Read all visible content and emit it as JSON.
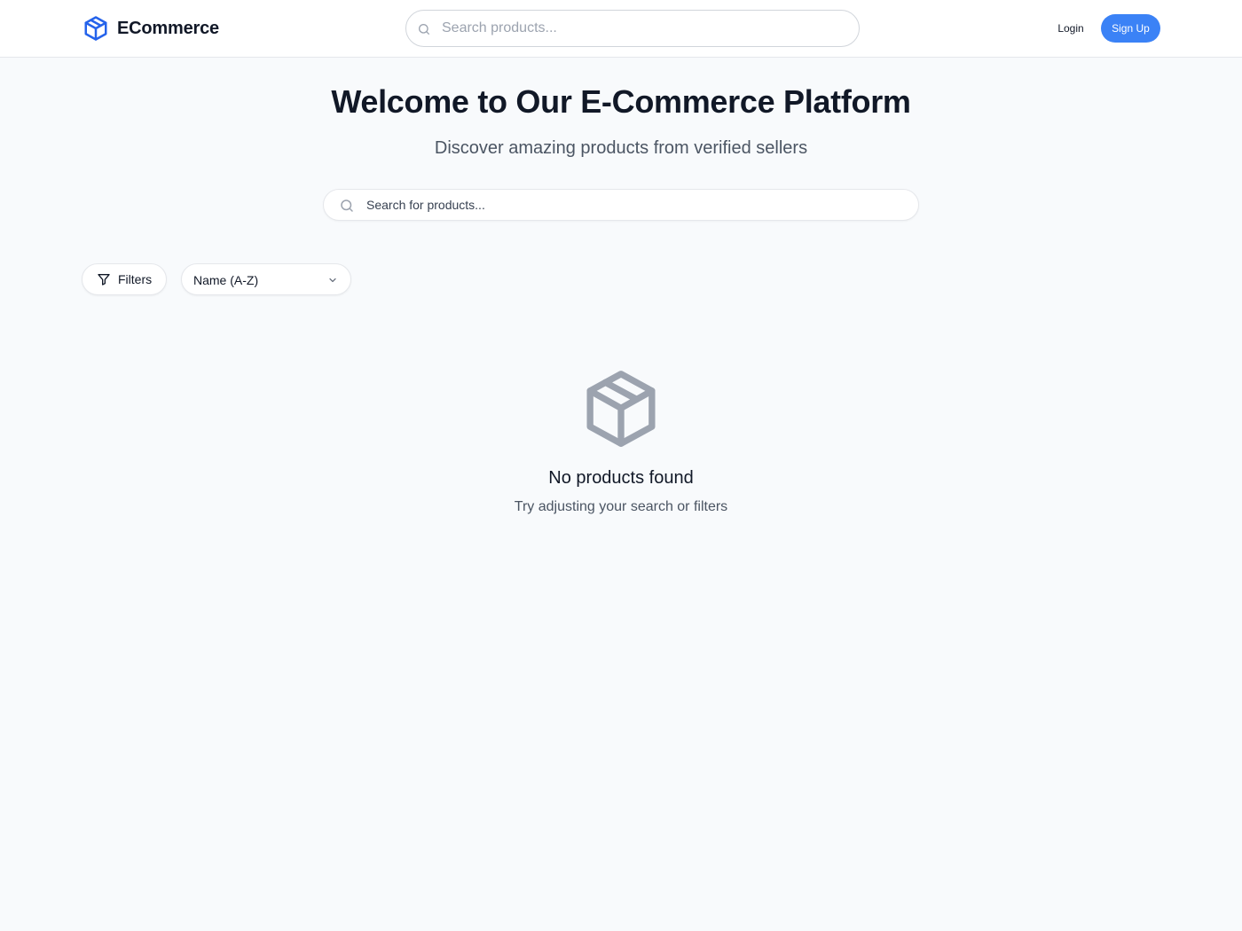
{
  "header": {
    "brand_name": "ECommerce",
    "search_placeholder": "Search products...",
    "login_label": "Login",
    "signup_label": "Sign Up"
  },
  "hero": {
    "title": "Welcome to Our E-Commerce Platform",
    "subtitle": "Discover amazing products from verified sellers",
    "search_placeholder": "Search for products..."
  },
  "toolbar": {
    "filters_label": "Filters",
    "sort_selected": "Name (A-Z)"
  },
  "empty_state": {
    "title": "No products found",
    "subtitle": "Try adjusting your search or filters"
  },
  "colors": {
    "accent": "#3b82f6",
    "brand_icon": "#2563eb",
    "empty_icon": "#9ca3af",
    "background": "#f8fafc"
  },
  "icons": {
    "brand": "package-icon",
    "search": "search-icon",
    "filter": "filter-icon",
    "chevron": "chevron-down-icon",
    "empty": "package-icon"
  }
}
